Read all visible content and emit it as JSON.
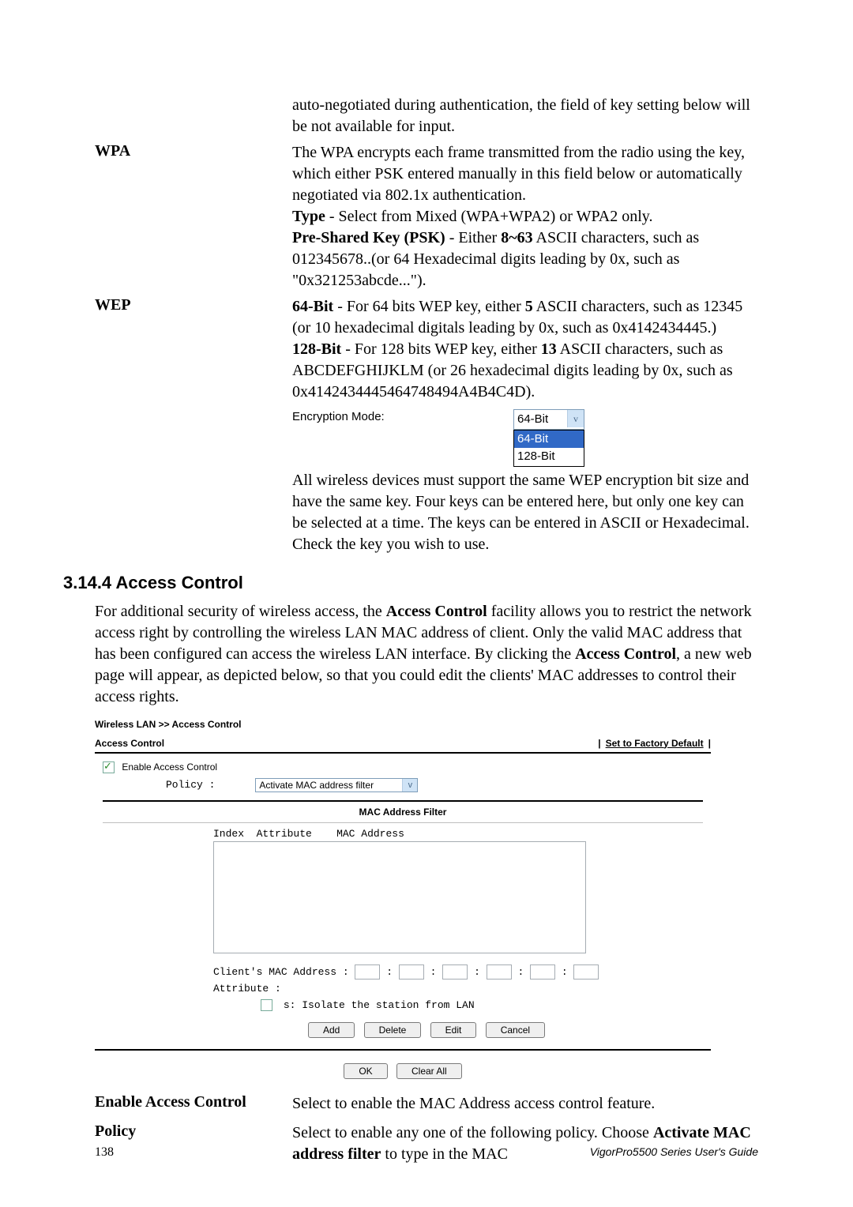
{
  "intro_para": "auto-negotiated during authentication, the field of key setting below will be not available for input.",
  "wpa": {
    "label": "WPA",
    "p1": "The WPA encrypts each frame transmitted from the radio using the key, which either PSK entered manually in this field below or automatically negotiated via 802.1x authentication.",
    "type_b": "Type",
    "type_rest": " - Select from Mixed (WPA+WPA2) or WPA2 only.",
    "psk_b": "Pre-Shared Key (PSK)",
    "psk_mid": " - Either ",
    "psk_b2": "8~63",
    "psk_rest": " ASCII characters, such as 012345678..(or 64 Hexadecimal digits leading by 0x, such as \"0x321253abcde...\")."
  },
  "wep": {
    "label": "WEP",
    "b64": "64-Bit",
    "b64_mid": " - For 64 bits WEP key, either ",
    "b5": "5",
    "b64_rest": " ASCII characters, such as 12345 (or 10 hexadecimal digitals leading by 0x, such as 0x4142434445.)",
    "b128": "128-Bit",
    "b128_mid": " - For 128 bits WEP key, either ",
    "b13": "13",
    "b128_rest": " ASCII characters, such as ABCDEFGHIJKLM (or 26 hexadecimal digits leading by 0x, such as 0x4142434445464748494A4B4C4D).",
    "enc_label": "Encryption Mode:",
    "sel_value": "64-Bit",
    "opt1": "64-Bit",
    "opt2": "128-Bit",
    "tail": "All wireless devices must support the same WEP encryption bit size and have the same key. Four keys can be entered here, but only one key can be selected at a time. The keys can be entered in ASCII or Hexadecimal. Check the key you wish to use."
  },
  "section_heading": "3.14.4 Access Control",
  "section_para_a": "For additional security of wireless access, the ",
  "section_para_b1": "Access Control",
  "section_para_c": " facility allows you to restrict the network access right by controlling the wireless LAN MAC address of client. Only the valid MAC address that has been configured can access the wireless LAN interface. By clicking the ",
  "section_para_b2": "Access Control",
  "section_para_d": ", a new web page will appear, as depicted below, so that you could edit the clients' MAC addresses to control their access rights.",
  "ui": {
    "breadcrumb": "Wireless LAN >> Access Control",
    "group_title": "Access Control",
    "factory": "Set to Factory Default",
    "enable_label": "Enable Access Control",
    "policy_label": "Policy :",
    "policy_value": "Activate MAC address filter",
    "mac_filter_title": "MAC Address Filter",
    "list_head_index": "Index",
    "list_head_attr": "Attribute",
    "list_head_mac": "MAC Address",
    "client_mac_label": "Client's MAC Address :",
    "attribute_label": "Attribute :",
    "isolate_label": "s: Isolate the station from LAN",
    "btn_add": "Add",
    "btn_delete": "Delete",
    "btn_edit": "Edit",
    "btn_cancel": "Cancel",
    "btn_ok": "OK",
    "btn_clear": "Clear All"
  },
  "defs": {
    "eac_label": "Enable Access Control",
    "eac_desc": "Select to enable the MAC Address access control feature.",
    "policy_label": "Policy",
    "policy_desc_a": "Select to enable any one of the following policy. Choose ",
    "policy_desc_b": "Activate MAC address filter",
    "policy_desc_c": " to type in the MAC"
  },
  "footer": {
    "page": "138",
    "guide": "VigorPro5500  Series  User's Guide"
  }
}
